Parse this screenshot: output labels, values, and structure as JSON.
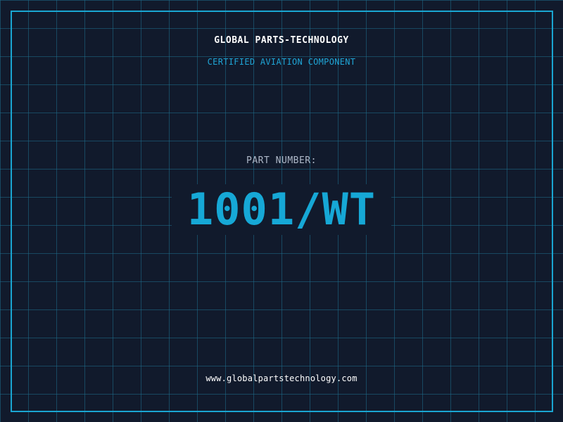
{
  "header": {
    "company_name": "GLOBAL PARTS-TECHNOLOGY",
    "subtitle": "CERTIFIED AVIATION COMPONENT"
  },
  "part": {
    "label": "PART NUMBER:",
    "number": "1001/WT"
  },
  "footer": {
    "website": "www.globalpartstechnology.com"
  },
  "colors": {
    "background": "#111a2c",
    "grid": "#1e6e8c",
    "frame": "#1aa6d2",
    "accent": "#16a8d6",
    "title_text": "#ffffff",
    "label_text": "#aeb8c8"
  }
}
